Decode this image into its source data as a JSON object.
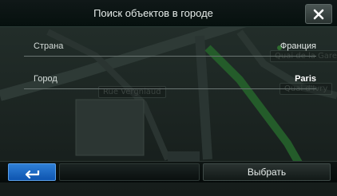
{
  "window": {
    "title": "Поиск объектов в городе",
    "close_icon": "close-icon"
  },
  "form": {
    "rows": [
      {
        "label": "Страна",
        "value": "Франция"
      },
      {
        "label": "Город",
        "value": "Paris"
      }
    ]
  },
  "map": {
    "streets": [
      "Quai de la Gare",
      "Rue Vergniaud",
      "Quai d'Ivry"
    ]
  },
  "footer": {
    "back_icon": "back-arrow-icon",
    "select_label": "Выбрать"
  },
  "colors": {
    "title_bar": "#06100e",
    "back_button": "#1a68c6",
    "row_divider": "#6a7572"
  }
}
